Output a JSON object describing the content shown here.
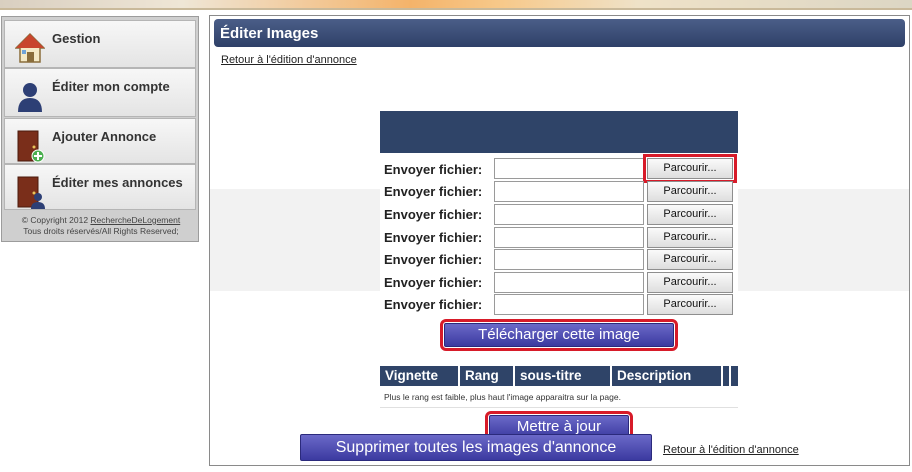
{
  "sidebar": {
    "items": [
      {
        "label": "Gestion",
        "icon": "house-icon"
      },
      {
        "label": "Éditer mon compte",
        "icon": "user-icon"
      },
      {
        "label": "Ajouter Annonce",
        "icon": "door-add-icon"
      },
      {
        "label": "Éditer mes annonces",
        "icon": "door-user-icon"
      }
    ],
    "copyright_prefix": "© Copyright 2012 ",
    "copyright_link": "RechercheDeLogement",
    "rights": "Tous droits réservés/All Rights Reserved;"
  },
  "main": {
    "title": "Éditer Images",
    "back_link_top": "Retour à l'édition d'annonce",
    "back_link_bottom": "Retour à l'édition d'annonce"
  },
  "upload": {
    "rows": [
      {
        "label": "Envoyer fichier:",
        "value": "",
        "button": "Parcourir..."
      },
      {
        "label": "Envoyer fichier:",
        "value": "",
        "button": "Parcourir..."
      },
      {
        "label": "Envoyer fichier:",
        "value": "",
        "button": "Parcourir..."
      },
      {
        "label": "Envoyer fichier:",
        "value": "",
        "button": "Parcourir..."
      },
      {
        "label": "Envoyer fichier:",
        "value": "",
        "button": "Parcourir..."
      },
      {
        "label": "Envoyer fichier:",
        "value": "",
        "button": "Parcourir..."
      },
      {
        "label": "Envoyer fichier:",
        "value": "",
        "button": "Parcourir..."
      }
    ],
    "upload_button": "Télécharger cette image"
  },
  "images_table": {
    "columns": [
      "Vignette",
      "Rang",
      "sous-titre",
      "Description"
    ],
    "note": "Plus le rang est faible, plus haut l'image apparaitra sur la page."
  },
  "actions": {
    "update_button": "Mettre à jour",
    "delete_all_button": "Supprimer toutes les images d'annonce"
  },
  "colors": {
    "header": "#2f4068",
    "button": "#4a48b0",
    "highlight": "#d71b29"
  }
}
